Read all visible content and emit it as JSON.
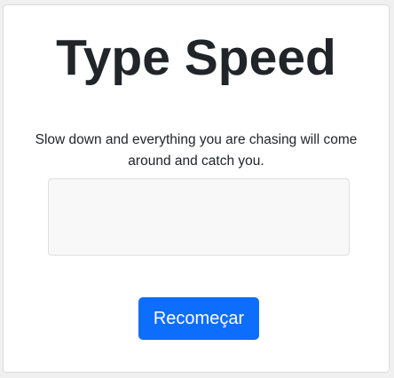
{
  "app": {
    "title": "Type Speed"
  },
  "quote": {
    "text": "Slow down and everything you are chasing will come around and catch you."
  },
  "typing_area": {
    "value": "",
    "placeholder": ""
  },
  "actions": {
    "restart_label": "Recomeçar"
  },
  "colors": {
    "accent": "#0d6efd",
    "text": "#212529",
    "input_background": "#f8f8f8"
  }
}
